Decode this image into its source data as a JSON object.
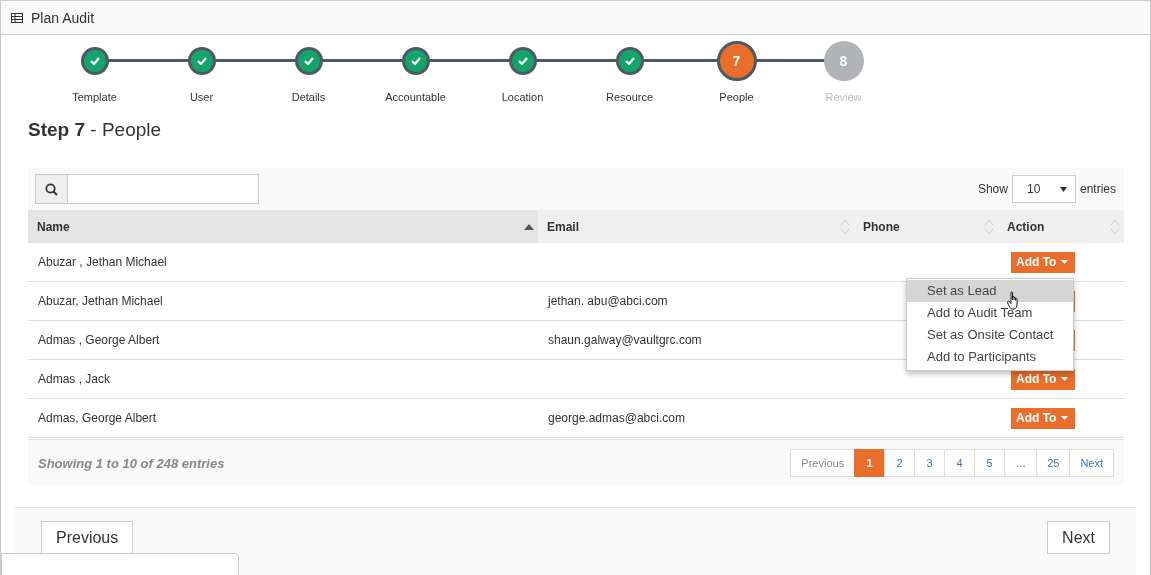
{
  "window": {
    "title": "Plan Audit"
  },
  "steps": [
    {
      "label": "Template",
      "completed": true,
      "current": false
    },
    {
      "label": "User",
      "completed": true,
      "current": false
    },
    {
      "label": "Details",
      "completed": true,
      "current": false
    },
    {
      "label": "Accountable",
      "completed": true,
      "current": false
    },
    {
      "label": "Location",
      "completed": true,
      "current": false
    },
    {
      "label": "Resource",
      "completed": true,
      "current": false
    },
    {
      "label": "People",
      "completed": false,
      "current": true,
      "number": "7"
    },
    {
      "label": "Review",
      "completed": false,
      "current": false,
      "number": "8"
    }
  ],
  "heading": {
    "step": "Step 7",
    "title": "- People"
  },
  "table": {
    "show_label": "Show",
    "page_size": "10",
    "entries_label": "entries",
    "columns": [
      {
        "label": "Name",
        "sorted_ascending": true
      },
      {
        "label": "Email",
        "sorted_ascending": false
      },
      {
        "label": "Phone",
        "sorted_ascending": false
      },
      {
        "label": "Action",
        "sorted_ascending": false
      }
    ],
    "rows": [
      {
        "name": "Abuzar , Jethan Michael",
        "email": "",
        "phone": "",
        "action": "Add To"
      },
      {
        "name": "Abuzar, Jethan Michael",
        "email": "jethan. abu@abci.com",
        "phone": ""
      },
      {
        "name": "Admas , George Albert",
        "email": "shaun.galway@vaultgrc.com",
        "phone": ""
      },
      {
        "name": "Admas , Jack",
        "email": "",
        "phone": "",
        "action": "Add To"
      },
      {
        "name": "Admas, George Albert",
        "email": "george.admas@abci.com",
        "phone": "",
        "action": "Add To"
      }
    ],
    "info": "Showing 1 to 10 of 248 entries",
    "pages": [
      {
        "label": "Previous",
        "selected": false
      },
      {
        "label": "1",
        "selected": true
      },
      {
        "label": "2",
        "selected": false
      },
      {
        "label": "3",
        "selected": false
      },
      {
        "label": "4",
        "selected": false
      },
      {
        "label": "5",
        "selected": false
      },
      {
        "label": "…",
        "selected": false
      },
      {
        "label": "25",
        "selected": false
      },
      {
        "label": "Next",
        "selected": false
      }
    ]
  },
  "dropdown": {
    "items": [
      {
        "label": "Set as Lead",
        "selected": true
      },
      {
        "label": "Add to Audit Team",
        "selected": false
      },
      {
        "label": "Set as Onsite Contact",
        "selected": false
      },
      {
        "label": "Add to Participants",
        "selected": false
      }
    ]
  },
  "footer": {
    "previous": "Previous",
    "next": "Next"
  }
}
